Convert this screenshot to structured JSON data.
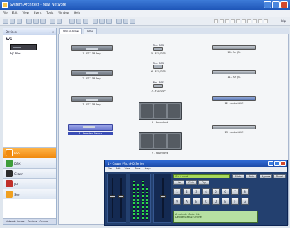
{
  "window": {
    "title": "System Architect – New Network"
  },
  "menu": [
    "File",
    "Edit",
    "View",
    "Event",
    "Tools",
    "Window",
    "Help"
  ],
  "toolbar": {
    "right_label": "Help"
  },
  "left_panel": {
    "title": "Devices",
    "group": "AVG",
    "device_label": "Hp.BSS",
    "categories": [
      {
        "label": "BSS",
        "color": "#f08a10",
        "active": true
      },
      {
        "label": "DBX",
        "color": "#3f9d3a"
      },
      {
        "label": "Crown",
        "color": "#2c2c2c"
      },
      {
        "label": "JBL",
        "color": "#c0302a"
      },
      {
        "label": "Soo",
        "color": "#f0a020"
      }
    ],
    "bottom_tabs": [
      "Network Access",
      "Devices",
      "Groups"
    ]
  },
  "doc_tabs": [
    "Venue View",
    "Files"
  ],
  "canvas_nodes": [
    {
      "label": "1 - FSX-1B Amp",
      "type": "amp"
    },
    {
      "label": "2 - FSX-1B Amp",
      "type": "amp"
    },
    {
      "label": "3 - FSX-1B Amp",
      "type": "amp"
    },
    {
      "label": "4 - Selected Device",
      "type": "selected"
    },
    {
      "label": "5 - FSX/DSP",
      "type": "small",
      "tiny": "Rev. BSS"
    },
    {
      "label": "6 - FSX/DSP",
      "type": "small",
      "tiny": "Rev. BSS"
    },
    {
      "label": "7 - FSX/DSP",
      "type": "small",
      "tiny": "Rev. BSS"
    },
    {
      "label": "8 - Soundweb",
      "type": "speaker"
    },
    {
      "label": "9 - Soundweb",
      "type": "speaker"
    },
    {
      "label": "10 - Air JBL",
      "type": "wide"
    },
    {
      "label": "11 - Air JBL",
      "type": "wide"
    },
    {
      "label": "12 - AudioSAVE",
      "type": "wide-hl"
    },
    {
      "label": "13 - AudioSAVE",
      "type": "wide"
    }
  ],
  "control_window": {
    "title": "1 - Crown I-Tech HD Series",
    "menu": [
      "File",
      "Edit",
      "View",
      "Tools",
      "Help"
    ],
    "lcd_top": "Ch 1 Input",
    "lcd_buttons": [
      "Mute",
      "Solo",
      "Bypass",
      "Recall"
    ],
    "small_buttons": [
      "Lim",
      "Gain",
      "Dly"
    ],
    "pad_keys": [
      "1",
      "2",
      "3",
      "4",
      "5",
      "6",
      "7",
      "8",
      "9",
      "A",
      "B",
      "C",
      "D",
      "E",
      "F",
      "G"
    ],
    "info_lines": [
      "Ampitude Mode: Ok",
      "Device Status: Online"
    ],
    "fader_level": 0.55
  }
}
